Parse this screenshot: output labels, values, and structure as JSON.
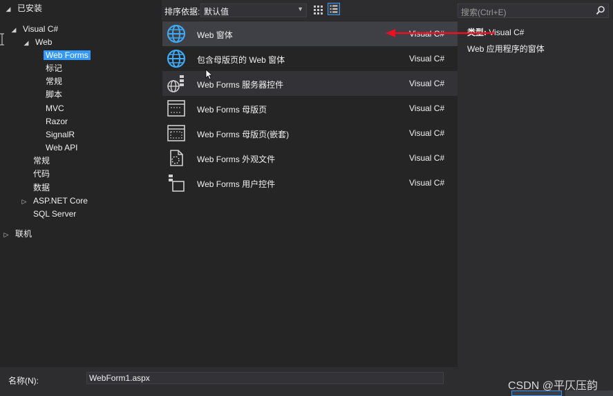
{
  "left_tree": {
    "installed": "已安装",
    "visual_csharp": "Visual C#",
    "web": "Web",
    "web_forms": "Web Forms",
    "biaoji": "标记",
    "changgui_sub": "常规",
    "jiaoben": "脚本",
    "mvc": "MVC",
    "razor": "Razor",
    "signalr": "SignalR",
    "web_api": "Web API",
    "changgui": "常规",
    "daima": "代码",
    "shuju": "数据",
    "aspnet_core": "ASP.NET Core",
    "sql_server": "SQL Server",
    "lianji": "联机"
  },
  "toolbar": {
    "sort_label": "排序依据:",
    "sort_value": "默认值"
  },
  "templates": [
    {
      "name": "Web 窗体",
      "lang": "Visual C#",
      "icon": "globe-icon"
    },
    {
      "name": "包含母版页的 Web 窗体",
      "lang": "Visual C#",
      "icon": "globe-icon"
    },
    {
      "name": "Web Forms 服务器控件",
      "lang": "Visual C#",
      "icon": "server-control-icon"
    },
    {
      "name": "Web Forms 母版页",
      "lang": "Visual C#",
      "icon": "master-page-icon"
    },
    {
      "name": "Web Forms 母版页(嵌套)",
      "lang": "Visual C#",
      "icon": "nested-master-page-icon"
    },
    {
      "name": "Web Forms 外观文件",
      "lang": "Visual C#",
      "icon": "skin-file-icon"
    },
    {
      "name": "Web Forms 用户控件",
      "lang": "Visual C#",
      "icon": "user-control-icon"
    }
  ],
  "details": {
    "search_placeholder": "搜索(Ctrl+E)",
    "type_key": "类型:",
    "type_value": "Visual C#",
    "description": "Web 应用程序的窗体"
  },
  "bottom": {
    "name_label": "名称(N):",
    "name_value": "WebForm1.aspx"
  },
  "watermark": "CSDN @平仄压韵",
  "colors": {
    "accent": "#3399ff",
    "arrow_red": "#e81123",
    "globe_blue": "#3fa9f5"
  }
}
